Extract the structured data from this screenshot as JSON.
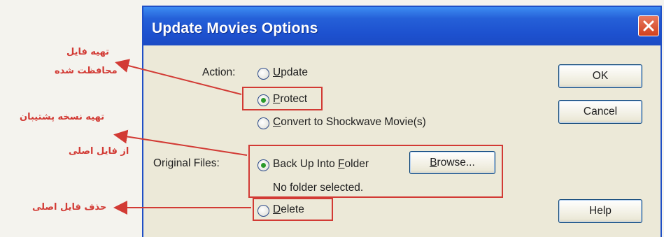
{
  "dialog": {
    "title": "Update Movies Options",
    "action_label": "Action:",
    "action_options": [
      {
        "label": "Update",
        "mnemonic": "U",
        "rest": "pdate",
        "checked": false
      },
      {
        "label": "Protect",
        "mnemonic": "P",
        "rest": "rotect",
        "checked": true
      },
      {
        "label": "Convert to Shockwave Movie(s)",
        "mnemonic": "C",
        "rest": "onvert to Shockwave Movie(s)",
        "checked": false
      }
    ],
    "original_files_label": "Original Files:",
    "backup_option": {
      "pre": "Back Up Into ",
      "mnemonic": "F",
      "rest": "older",
      "checked": true
    },
    "browse_button": {
      "mnemonic": "B",
      "rest": "rowse..."
    },
    "no_folder_text": "No folder selected.",
    "delete_option": {
      "mnemonic": "D",
      "rest": "elete",
      "checked": false
    },
    "ok_button": "OK",
    "cancel_button": "Cancel",
    "help_button": "Help"
  },
  "annotations": {
    "protect_note_line1": "تهیه فایل",
    "protect_note_line2": "محافظت شده",
    "backup_note_line1": "تهیه نسخه پشتیبان",
    "backup_note_line2": "از فایل اصلی",
    "delete_note": "حذف فایل اصلی"
  },
  "colors": {
    "annotation": "#d23a34",
    "titlebar": "#2560d8",
    "dialog_bg": "#ece9d8"
  }
}
